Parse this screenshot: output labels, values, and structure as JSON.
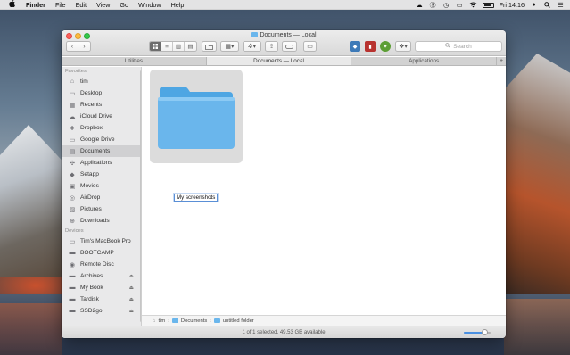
{
  "menubar": {
    "app": "Finder",
    "items": [
      "File",
      "Edit",
      "View",
      "Go",
      "Window",
      "Help"
    ],
    "clock": "Fri 14:16",
    "icons": [
      "cloud-icon",
      "skype-icon",
      "time-machine-icon",
      "display-icon",
      "wifi-icon",
      "battery-icon",
      "user-icon",
      "spotlight-icon",
      "notification-icon"
    ]
  },
  "window": {
    "title": "Documents — Local",
    "toolbar": {
      "search_placeholder": "Search",
      "view_modes": [
        "icon",
        "list",
        "column",
        "gallery"
      ],
      "active_view": "icon"
    },
    "tabs": [
      {
        "label": "Utilities",
        "active": false
      },
      {
        "label": "Documents — Local",
        "active": true
      },
      {
        "label": "Applications",
        "active": false
      }
    ],
    "sidebar": {
      "favorites_header": "Favorites",
      "favorites": [
        {
          "label": "tim",
          "icon": "home-icon"
        },
        {
          "label": "Desktop",
          "icon": "desktop-icon"
        },
        {
          "label": "Recents",
          "icon": "recents-icon"
        },
        {
          "label": "iCloud Drive",
          "icon": "cloud-icon"
        },
        {
          "label": "Dropbox",
          "icon": "dropbox-icon"
        },
        {
          "label": "Google Drive",
          "icon": "folder-icon"
        },
        {
          "label": "Documents",
          "icon": "document-icon",
          "selected": true
        },
        {
          "label": "Applications",
          "icon": "applications-icon"
        },
        {
          "label": "Setapp",
          "icon": "setapp-icon"
        },
        {
          "label": "Movies",
          "icon": "movies-icon"
        },
        {
          "label": "AirDrop",
          "icon": "airdrop-icon"
        },
        {
          "label": "Pictures",
          "icon": "pictures-icon"
        },
        {
          "label": "Downloads",
          "icon": "downloads-icon"
        }
      ],
      "devices_header": "Devices",
      "devices": [
        {
          "label": "Tim's MacBook Pro",
          "icon": "laptop-icon",
          "eject": false
        },
        {
          "label": "BOOTCAMP",
          "icon": "disk-icon",
          "eject": false
        },
        {
          "label": "Remote Disc",
          "icon": "disc-icon",
          "eject": false
        },
        {
          "label": "Archives",
          "icon": "disk-icon",
          "eject": true
        },
        {
          "label": "My Book",
          "icon": "disk-icon",
          "eject": true
        },
        {
          "label": "Tardisk",
          "icon": "disk-icon",
          "eject": true
        },
        {
          "label": "SSD2go",
          "icon": "disk-icon",
          "eject": true
        }
      ]
    },
    "content": {
      "item_name": "My screenshots"
    },
    "pathbar": [
      "tim",
      "Documents",
      "untitled folder"
    ],
    "status": "1 of 1 selected, 49.53 GB available",
    "icon_size_slider": 0.75,
    "colors": {
      "folder_blue": "#6ab6ec",
      "selection_gray": "#d0d0d2"
    }
  }
}
